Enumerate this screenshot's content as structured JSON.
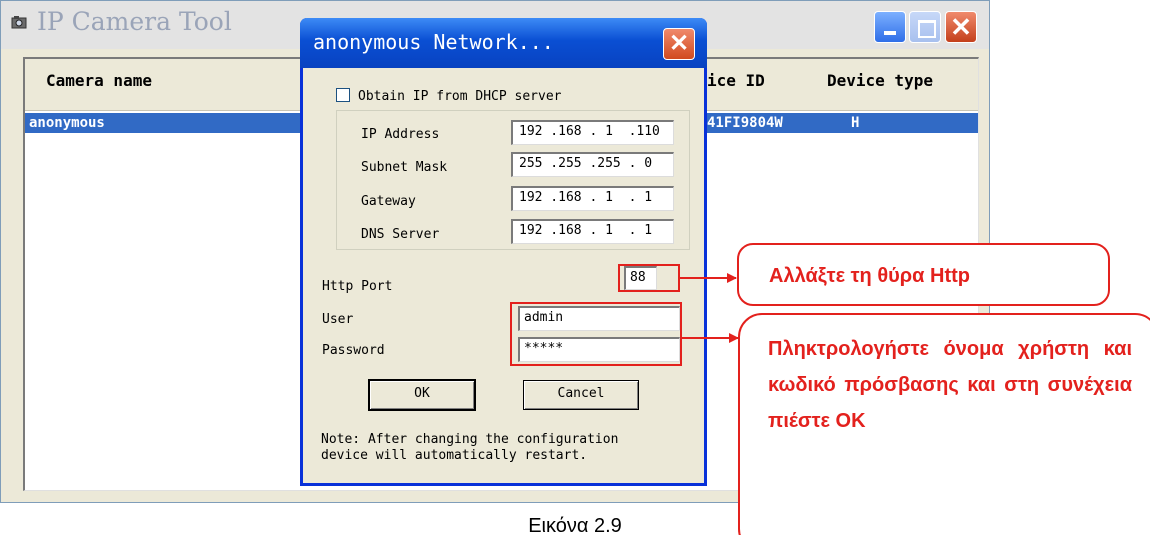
{
  "main_window": {
    "title": "IP Camera Tool",
    "columns": {
      "camera_name": "Camera name",
      "device_id": "ice ID",
      "device_type": "Device type"
    },
    "selected_row": {
      "camera_name": "anonymous",
      "device_id": "41FI9804W",
      "device_type": "H"
    }
  },
  "dialog": {
    "title": "anonymous Network...",
    "dhcp_checkbox": {
      "label": "Obtain IP from DHCP server",
      "checked": false
    },
    "ip_address": {
      "label": "IP Address",
      "value": "192 .168 . 1  .110"
    },
    "subnet_mask": {
      "label": "Subnet Mask",
      "value": "255 .255 .255 . 0"
    },
    "gateway": {
      "label": "Gateway",
      "value": "192 .168 . 1  . 1"
    },
    "dns_server": {
      "label": "DNS Server",
      "value": "192 .168 . 1  . 1"
    },
    "http_port": {
      "label": "Http Port",
      "value": "88"
    },
    "user": {
      "label": "User",
      "value": "admin"
    },
    "password": {
      "label": "Password",
      "value": "*****"
    },
    "ok_label": "OK",
    "cancel_label": "Cancel",
    "note": "Note: After changing the configuration\ndevice will automatically restart."
  },
  "annotations": {
    "http_port_callout": "Αλλάξτε τη θύρα Http",
    "credentials_callout": "Πληκτρολογήστε όνομα χρήστη και κωδικό πρόσβασης και στη συνέχεια πιέστε OK",
    "highlight_color": "#e3211d"
  },
  "caption": "Εικόνα 2.9",
  "colors": {
    "selection": "#316ac5",
    "dialog_title": "#0a4fd3",
    "window_face": "#ece9d8"
  }
}
